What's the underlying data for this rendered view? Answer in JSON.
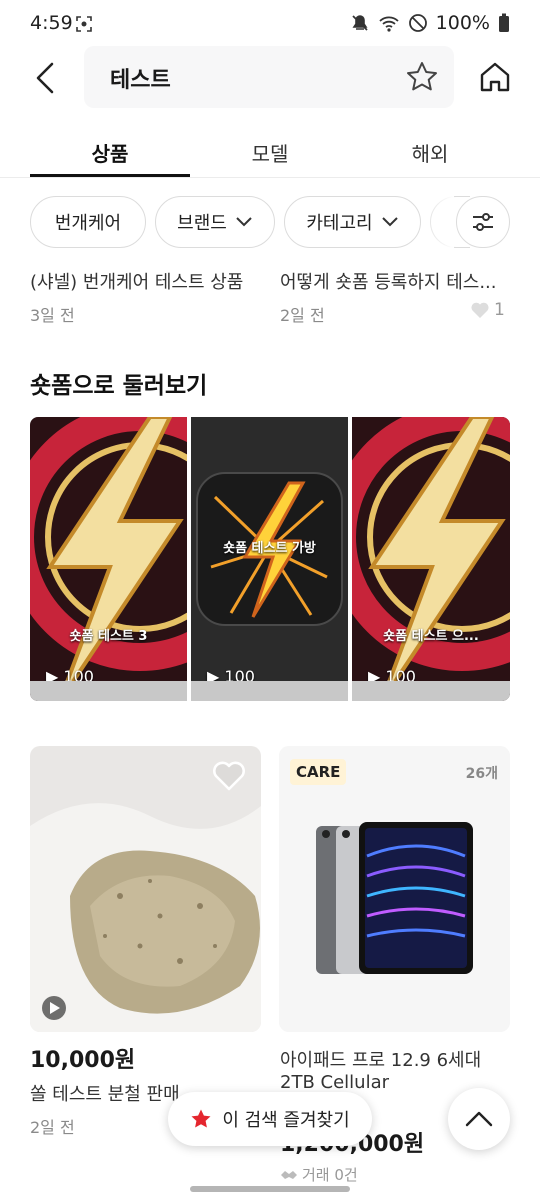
{
  "status_bar": {
    "time": "4:59",
    "battery": "100%"
  },
  "header": {
    "query": "테스트"
  },
  "tabs": [
    {
      "label": "상품"
    },
    {
      "label": "모델"
    },
    {
      "label": "해외"
    }
  ],
  "chips": [
    {
      "label": "번개케어"
    },
    {
      "label": "브랜드"
    },
    {
      "label": "카테고리"
    }
  ],
  "top_products": [
    {
      "title": "(샤넬) 번개케어 테스트 상품",
      "date": "3일 전"
    },
    {
      "title": "어떻게 숏폼 등록하지 테스...",
      "date": "2일 전",
      "likes": "1"
    }
  ],
  "section": {
    "title": "숏폼으로 둘러보기"
  },
  "shorts": [
    {
      "caption": "숏폼 테스트 3",
      "views": "100"
    },
    {
      "caption": "숏폼 테스트 가방",
      "views": "100"
    },
    {
      "caption": "숏폼 테스트 으...",
      "views": "100"
    }
  ],
  "products": [
    {
      "price": "10,000원",
      "title": "쏠 테스트 분철 판매",
      "date": "2일 전"
    },
    {
      "badge": "CARE",
      "count": "26개",
      "title_line1": "아이패드 프로 12.9 6세대",
      "title_line2": "2TB Cellular",
      "price": "1,200,000원",
      "trade": "거래 0건"
    }
  ],
  "floating": {
    "favorite_label": "이 검색 즐겨찾기"
  },
  "colors": {
    "accent_red": "#e4262e",
    "badge_bg": "#fff3d6"
  }
}
